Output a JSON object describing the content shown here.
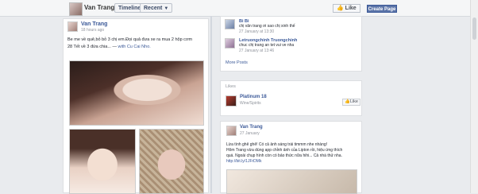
{
  "topbar": {
    "profile_name": "Van Trang",
    "timeline_label": "Timeline",
    "recent_label": "Recent",
    "like_label": "Like",
    "create_page_label": "Create Page"
  },
  "post_main": {
    "author": "Van Trang",
    "time": "18 hours ago",
    "text_line1": "Be me về quê,bỏ bỏ 3 chị em.Đọi quả đưa xe ra mua 2 hộp cơm",
    "text_line2_prefix": "28 Tết về 3 đứa chia... —",
    "text_line2_link": "with Cu Cai Nho."
  },
  "comments": [
    {
      "author": "Bi Bi",
      "text": "chị vân trang ơi sao chị xinh thế",
      "time": "27 January at 13:30"
    },
    {
      "author": "Letruongchinh Truongchinh",
      "text": "chuc chị trang an tet vui ve nha",
      "time": "27 January at 13:46"
    }
  ],
  "more_posts_label": "More Posts",
  "likes_section": {
    "label": "Likes",
    "page_name": "Platinum 18",
    "page_category": "Wine/Spirits",
    "like_label": "Like"
  },
  "post_second": {
    "author": "Van Trang",
    "time": "27 January",
    "line1": "Lừa tình ghê ghê! Có cả ảnh sáng trái timmm nhe nhàng!",
    "line2": "Hôm Trang vừa dùng app chỉnh ảnh của Lipton rồi, hiệu ứng thích",
    "line3": "quá. Ngoài chụp hình còn có bảo thức nữa hihi... Cả nhà thử nha.",
    "link": "http://bit.ly/1JFrDMk"
  }
}
